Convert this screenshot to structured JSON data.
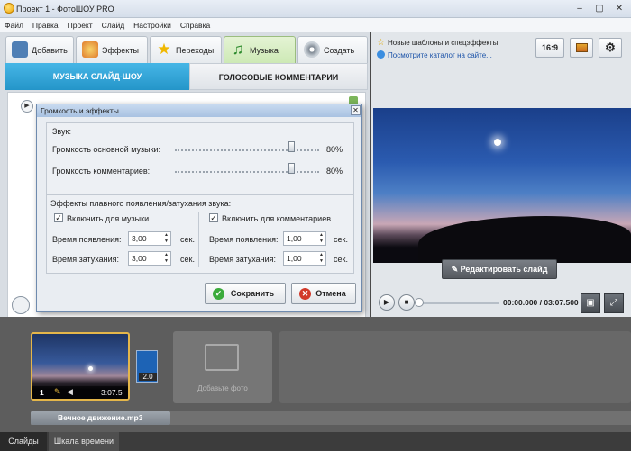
{
  "window": {
    "title": "Проект 1 - ФотоШОУ PRO"
  },
  "menu": [
    "Файл",
    "Правка",
    "Проект",
    "Слайд",
    "Настройки",
    "Справка"
  ],
  "tabs": [
    {
      "label": "Добавить",
      "icon": "add-photo-icon"
    },
    {
      "label": "Эффекты",
      "icon": "palette-icon"
    },
    {
      "label": "Переходы",
      "icon": "star-icon"
    },
    {
      "label": "Музыка",
      "icon": "music-note-icon"
    },
    {
      "label": "Создать",
      "icon": "film-reel-icon"
    }
  ],
  "subtabs": {
    "music": "МУЗЫКА СЛАЙД-ШОУ",
    "voice": "ГОЛОСОВЫЕ КОММЕНТАРИИ"
  },
  "news": {
    "line1": "Новые шаблоны и спецэффекты",
    "line2": "Посмотрите каталог на сайте..."
  },
  "aspect": "16:9",
  "preview": {
    "edit_label": "Редактировать слайд",
    "time": "00:00.000 / 03:07.500",
    "progress": 0
  },
  "dialog": {
    "title": "Громкость и эффекты",
    "sound_group": "Звук:",
    "music_volume_label": "Громкость основной музыки:",
    "music_volume": "80%",
    "comment_volume_label": "Громкость комментариев:",
    "comment_volume": "80%",
    "fade_group": "Эффекты плавного появления/затухания звука:",
    "music_check": "Включить для музыки",
    "comment_check": "Включить для комментариев",
    "appear_label": "Время появления:",
    "fade_label": "Время затухания:",
    "music_appear": "3,00",
    "music_fade": "3,00",
    "comment_appear": "1,00",
    "comment_fade": "1,00",
    "unit": "сек.",
    "save": "Сохранить",
    "cancel": "Отмена"
  },
  "filmstrip": {
    "slide_number": "1",
    "slide_duration": "3:07.5",
    "transition_duration": "2.0",
    "add_photo": "Добавьте фото",
    "audio_file": "Вечное движение.mp3"
  },
  "bottom_tabs": [
    "Слайды",
    "Шкала времени"
  ]
}
